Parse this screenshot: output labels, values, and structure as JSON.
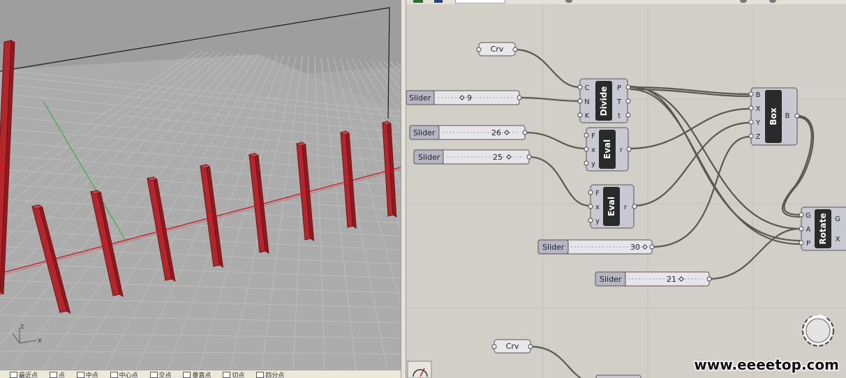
{
  "viewport": {
    "axis_labels": {
      "x": "x",
      "z": "z"
    },
    "colors": {
      "background": "#a6a6a6",
      "grid": "#bcbcbc",
      "box": "#b3262b",
      "curve": "#c0202a",
      "y_axis": "#3fa84a"
    }
  },
  "rhino_status": {
    "items": [
      "最近点",
      "点",
      "中点",
      "中心点",
      "交点",
      "垂直点",
      "切点",
      "四分点"
    ]
  },
  "grasshopper": {
    "nodes": {
      "crv1": {
        "label": "Crv"
      },
      "crv2": {
        "label": "Crv"
      },
      "slider1": {
        "label": "Slider",
        "value": "9"
      },
      "slider2": {
        "label": "Slider",
        "value": "26"
      },
      "slider3": {
        "label": "Slider",
        "value": "25"
      },
      "slider4": {
        "label": "Slider",
        "value": "30"
      },
      "slider5": {
        "label": "Slider",
        "value": "21"
      },
      "divide": {
        "title": "Divide",
        "inputs": [
          "C",
          "N",
          "K"
        ],
        "outputs": [
          "P",
          "T",
          "t"
        ]
      },
      "eval1": {
        "title": "Eval",
        "inputs": [
          "F",
          "x",
          "y"
        ],
        "outputs": [
          "r"
        ]
      },
      "eval2": {
        "title": "Eval",
        "inputs": [
          "F",
          "x",
          "y"
        ],
        "outputs": [
          "r"
        ]
      },
      "box": {
        "title": "Box",
        "inputs": [
          "B",
          "X",
          "Y",
          "Z"
        ],
        "outputs": [
          "B"
        ]
      },
      "rotate": {
        "title": "Rotate",
        "inputs": [
          "G",
          "A",
          "P"
        ],
        "outputs": [
          "G",
          "X"
        ]
      }
    },
    "colors": {
      "canvas": "#d2cfc8",
      "node_body": "#c9c9d4",
      "node_title": "#2a2a2a",
      "wire": "#5a5650",
      "slider_label": "#b5b5c4"
    }
  },
  "watermark": {
    "text": "www.eeeetop.com"
  }
}
